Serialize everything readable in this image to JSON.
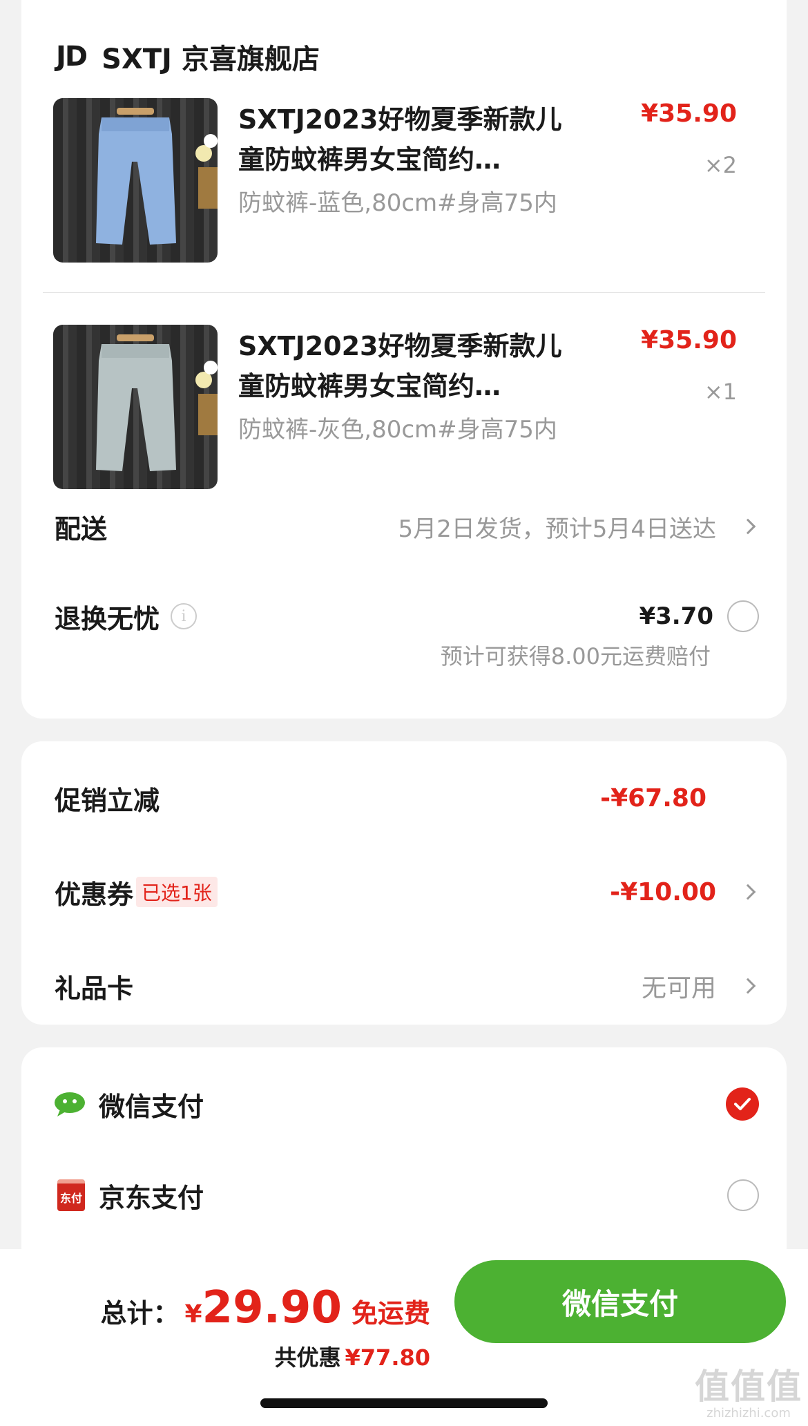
{
  "store": {
    "logo": "JD",
    "name": "SXTJ 京喜旗舰店"
  },
  "products": [
    {
      "title": "SXTJ2023好物夏季新款儿童防蚊裤男女宝简约…",
      "spec": "防蚊裤-蓝色,80cm#身高75内",
      "price": "¥35.90",
      "qty": "×2",
      "color": "#8fb2e0"
    },
    {
      "title": "SXTJ2023好物夏季新款儿童防蚊裤男女宝简约…",
      "spec": "防蚊裤-灰色,80cm#身高75内",
      "price": "¥35.90",
      "qty": "×1",
      "color": "#b7c3c4"
    }
  ],
  "delivery": {
    "label": "配送",
    "value": "5月2日发货，预计5月4日送达"
  },
  "return_insurance": {
    "label": "退换无忧",
    "info_icon": "i",
    "price": "¥3.70",
    "note": "预计可获得8.00元运费赔付"
  },
  "promo": {
    "label": "促销立减",
    "value": "-¥67.80"
  },
  "coupon": {
    "label": "优惠券",
    "badge": "已选1张",
    "value": "-¥10.00"
  },
  "gift_card": {
    "label": "礼品卡",
    "value": "无可用"
  },
  "payment": {
    "wechat_label": "微信支付",
    "jdpay_label": "京东支付",
    "jdpay_icon_text": "东付",
    "selected": "wechat"
  },
  "footer": {
    "total_label": "总计：",
    "currency": "¥",
    "total": "29.90",
    "free_shipping": "免运费",
    "saved_label": "共优惠",
    "saved_value": "¥77.80",
    "pay_button": "微信支付"
  },
  "watermark": {
    "big": "值值值",
    "small": "zhizhizhi.com"
  },
  "colors": {
    "accent": "#e2231a",
    "wechat_green": "#4cb132"
  }
}
